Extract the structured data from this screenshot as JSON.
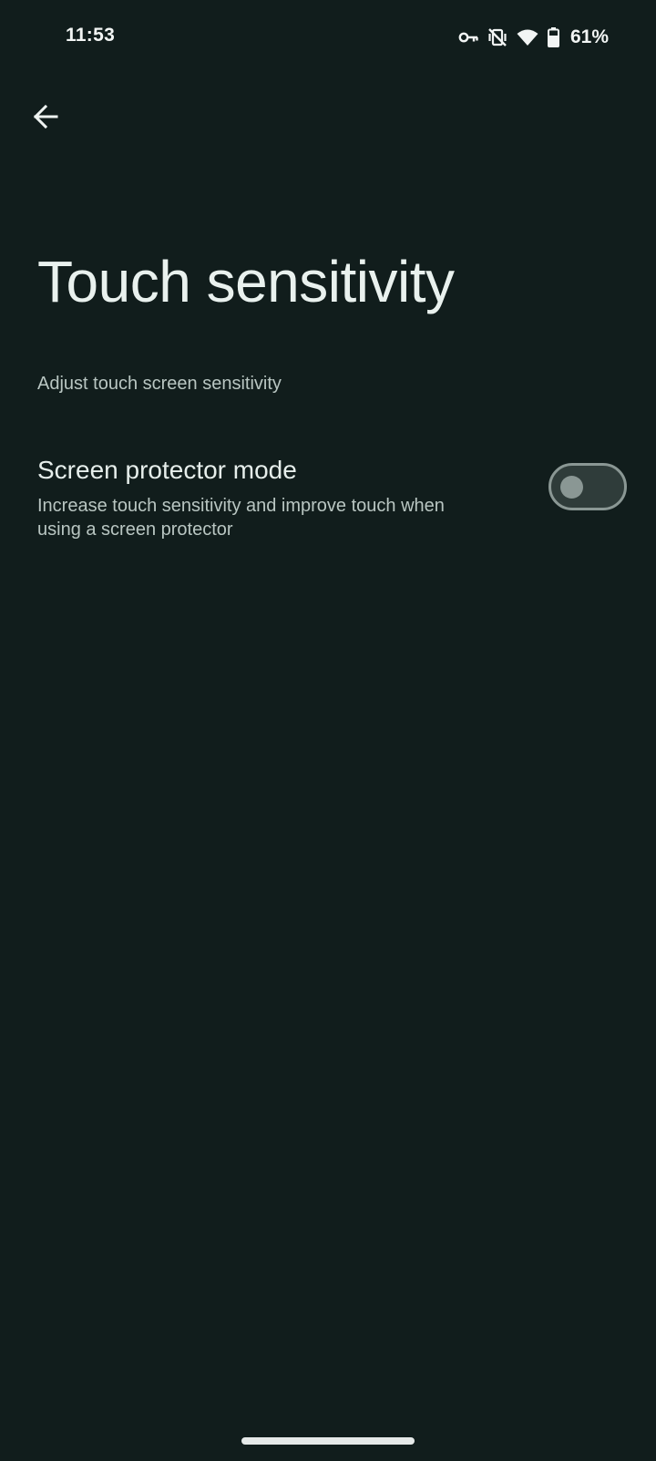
{
  "status_bar": {
    "time": "11:53",
    "battery_percent": "61%",
    "icons": [
      "vpn-key-icon",
      "vibrate-off-icon",
      "wifi-icon",
      "battery-icon"
    ]
  },
  "toolbar": {
    "back_icon": "arrow-back-icon"
  },
  "page": {
    "title": "Touch sensitivity",
    "description": "Adjust touch screen sensitivity"
  },
  "settings": [
    {
      "title": "Screen protector mode",
      "summary": "Increase touch sensitivity and improve touch when using a screen protector",
      "enabled": false
    }
  ],
  "colors": {
    "background": "#111d1c",
    "text_primary": "#e6eeeb",
    "text_secondary": "#b9c6c2",
    "toggle_off_outline": "#8a9794"
  }
}
